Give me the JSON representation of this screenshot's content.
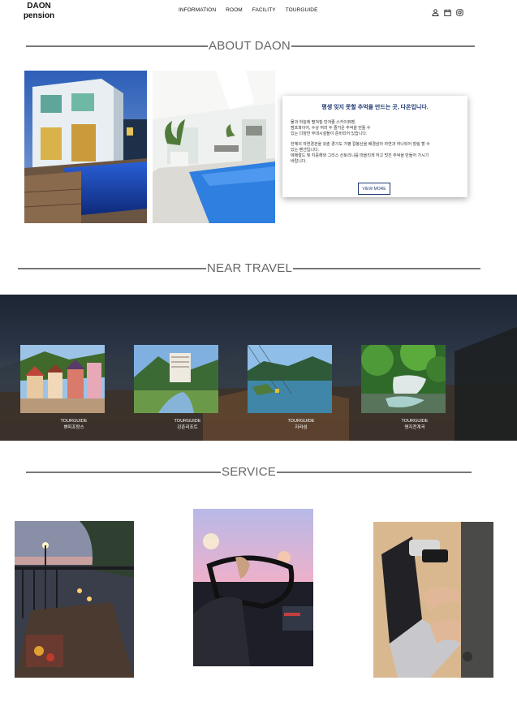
{
  "header": {
    "logo_line1": "DAON",
    "logo_line2": "pension",
    "nav": [
      "INFORMATION",
      "ROOM",
      "FACILITY",
      "TOURGUIDE"
    ],
    "icons": [
      "user-icon",
      "calendar-icon",
      "instagram-icon"
    ]
  },
  "about": {
    "title": "ABOUT DAON",
    "card_heading": "평생 잊지 못할 추억을 만드는 곳, 다온입니다.",
    "paragraph1": [
      "물과 하늘에 펼쳐질 반겨줄 스카이뷰펜,",
      "캠프파이어, 수상 여러 두 즐거운 추억을 만들 수",
      "있는 다양한 부대시설들이 준비되어 있습니다."
    ],
    "paragraph2": [
      "천혜의 자연경관을 갖춘 경기도 가평 칼봉산을 배경삼아 자연과 하나되어 힐링 할 수",
      "있는 펜션입니다.",
      "에메랄드 빛 지중해와 그리스 산토리니를 떠올리게 하고 멋진 추억을 만들어 가시기",
      "바랍니다."
    ],
    "more_label": "VIEW MORE"
  },
  "near_travel": {
    "title": "NEAR TRAVEL",
    "items": [
      {
        "tag": "TOURGUIDE",
        "name": "쁘띠프랑스"
      },
      {
        "tag": "TOURGUIDE",
        "name": "강촌리조트"
      },
      {
        "tag": "TOURGUIDE",
        "name": "자라섬"
      },
      {
        "tag": "TOURGUIDE",
        "name": "명지천계곡"
      }
    ]
  },
  "service": {
    "title": "SERVICE"
  }
}
